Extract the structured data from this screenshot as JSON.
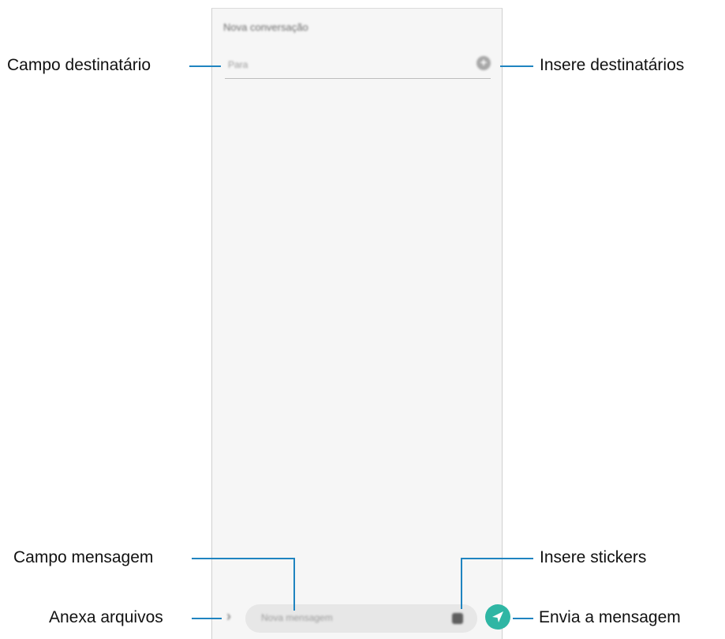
{
  "screen": {
    "title": "Nova conversação",
    "recipient_placeholder": "Para",
    "message_placeholder": "Nova mensagem"
  },
  "callouts": {
    "recipient_field": "Campo destinatário",
    "add_recipients": "Insere destinatários",
    "message_field": "Campo mensagem",
    "stickers": "Insere stickers",
    "attach_files": "Anexa arquivos",
    "send_message": "Envia a mensagem"
  },
  "colors": {
    "leader_line": "#1f84c0",
    "send_button": "#2fb6a4"
  },
  "icons": {
    "add_recipient": "plus-circle-icon",
    "attach": "chevron-right-icon",
    "sticker": "sticker-icon",
    "send": "send-icon"
  }
}
